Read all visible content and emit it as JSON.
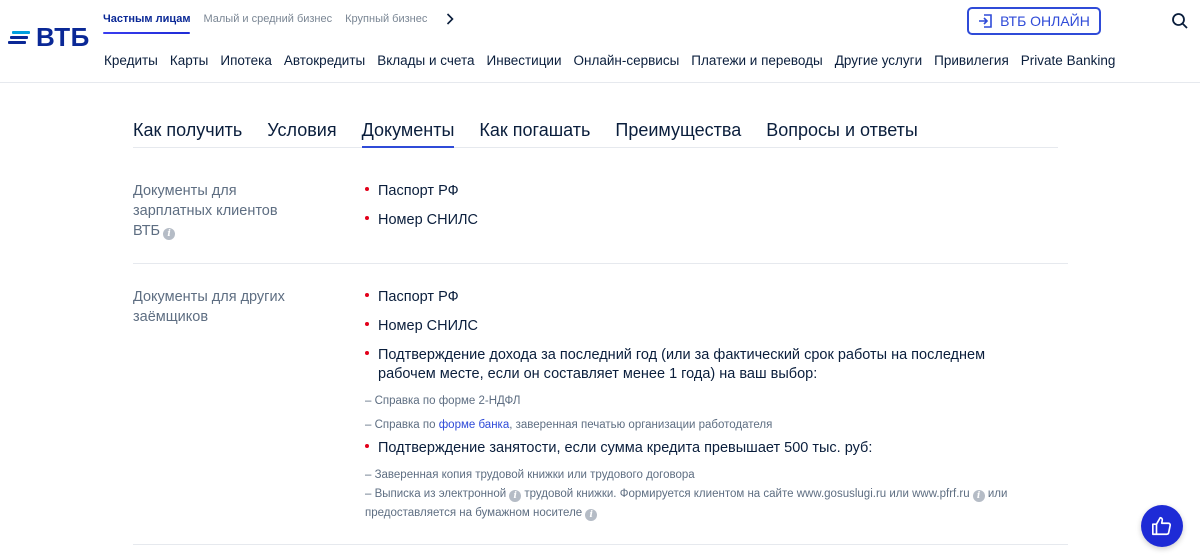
{
  "brand": {
    "logo_text": "ВТБ"
  },
  "segments": [
    {
      "label": "Частным лицам",
      "active": true
    },
    {
      "label": "Малый и средний бизнес",
      "active": false
    },
    {
      "label": "Крупный бизнес",
      "active": false
    }
  ],
  "online_button": {
    "label": "ВТБ ОНЛАЙН"
  },
  "nav": [
    "Кредиты",
    "Карты",
    "Ипотека",
    "Автокредиты",
    "Вклады и счета",
    "Инвестиции",
    "Онлайн-сервисы",
    "Платежи и переводы",
    "Другие услуги",
    "Привилегия",
    "Private Banking"
  ],
  "tabs": [
    {
      "label": "Как получить",
      "active": false
    },
    {
      "label": "Условия",
      "active": false
    },
    {
      "label": "Документы",
      "active": true
    },
    {
      "label": "Как погашать",
      "active": false
    },
    {
      "label": "Преимущества",
      "active": false
    },
    {
      "label": "Вопросы и ответы",
      "active": false
    }
  ],
  "sections": {
    "salary": {
      "title_line1": "Документы для",
      "title_line2": "зарплатных клиентов",
      "title_line3": "ВТБ",
      "items": [
        "Паспорт РФ",
        "Номер СНИЛС"
      ]
    },
    "others": {
      "title_line1": "Документы для других",
      "title_line2": "заёмщиков",
      "item1": "Паспорт РФ",
      "item2": "Номер СНИЛС",
      "item3_line1": "Подтверждение дохода за последний год (или за фактический срок работы на последнем",
      "item3_line2": "рабочем месте, если он составляет менее 1 года) на ваш выбор:",
      "sub1": "– Справка по форме 2-НДФЛ",
      "sub2_pre": "– Справка по ",
      "sub2_link": "форме банка",
      "sub2_post": ", заверенная печатью организации работодателя",
      "item4": "Подтверждение занятости, если сумма кредита превышает 500 тыс. руб:",
      "sub3": "– Заверенная копия трудовой книжки или трудового договора",
      "sub4_pre": "– Выписка из электронной",
      "sub4_mid": " трудовой книжки. Формируется клиентом на сайте www.gosuslugi.ru или www.pfrf.ru",
      "sub4_post": " или",
      "sub5": "предоставляется на бумажном носителе"
    }
  },
  "colors": {
    "brand_blue": "#0a2896",
    "accent_blue": "#2f4bd8",
    "bullet_red": "#e2001a"
  }
}
